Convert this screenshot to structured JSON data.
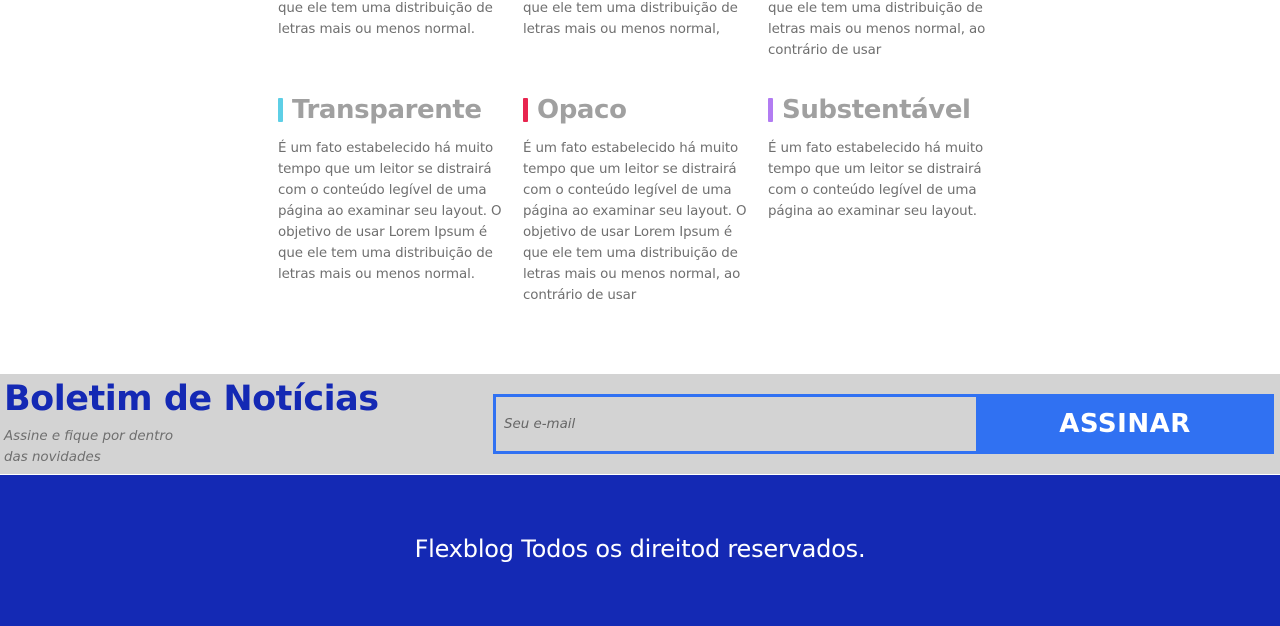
{
  "top_row": [
    {
      "lines": [
        "que ele tem uma distribuição de",
        "letras mais ou menos normal."
      ]
    },
    {
      "lines": [
        "que ele tem uma distribuição de",
        "letras mais ou menos normal,"
      ]
    },
    {
      "lines": [
        "que ele tem uma distribuição de",
        "letras mais ou menos normal, ao",
        "contrário de usar"
      ]
    }
  ],
  "features": [
    {
      "title": "Transparente",
      "accent": "#5ecfe6",
      "lines": [
        "É um fato estabelecido há muito",
        "tempo que um leitor se distrairá",
        "com o conteúdo legível de uma",
        "página ao examinar seu layout. O",
        "objetivo de usar Lorem Ipsum é",
        "que ele tem uma distribuição de",
        "letras mais ou menos normal."
      ]
    },
    {
      "title": "Opaco",
      "accent": "#e8254f",
      "lines": [
        "É um fato estabelecido há muito",
        "tempo que um leitor se distrairá",
        "com o conteúdo legível de uma",
        "página ao examinar seu layout. O",
        "objetivo de usar Lorem Ipsum é",
        "que ele tem uma distribuição de",
        "letras mais ou menos normal, ao",
        "contrário de usar"
      ]
    },
    {
      "title": "Substentável",
      "accent": "#b27cf2",
      "lines": [
        "É um fato estabelecido há muito",
        "tempo que um leitor se distrairá",
        "com o conteúdo legível de uma",
        "página ao examinar seu layout."
      ]
    }
  ],
  "newsletter": {
    "title": "Boletim de Notícias",
    "subtitle_lines": [
      "Assine e fique por dentro",
      "das novidades"
    ],
    "email_placeholder": "Seu e-mail",
    "button_label": "ASSINAR"
  },
  "footer": {
    "text": "Flexblog Todos os direitod reservados."
  },
  "colors": {
    "brand_blue": "#1429b4",
    "button_blue": "#3071f2",
    "newsletter_bg": "#d3d3d3"
  }
}
